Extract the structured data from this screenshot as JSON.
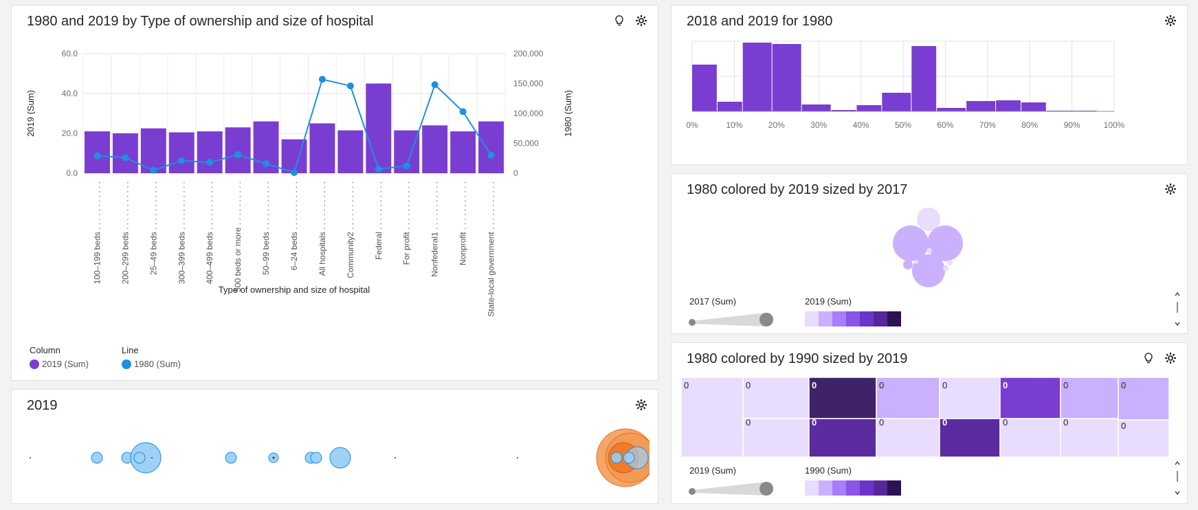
{
  "panel1": {
    "title": "1980 and 2019 by Type of ownership and size of hospital",
    "legend": {
      "column_heading": "Column",
      "line_heading": "Line",
      "column_series": "2019 (Sum)",
      "line_series": "1980 (Sum)"
    },
    "colors": {
      "column": "#7a3dd1",
      "line": "#1e90e0"
    }
  },
  "panel2": {
    "title": "2018 and 2019 for 1980"
  },
  "panel3": {
    "title": "1980 colored by 2019 sized by 2017",
    "size_legend": "2017 (Sum)",
    "color_legend": "2019 (Sum)"
  },
  "panel4": {
    "title": "1980 colored by 1990 sized by 2019",
    "size_legend": "2019 (Sum)",
    "color_legend": "1990 (Sum)",
    "cell_value": "0"
  },
  "panel5": {
    "title": "2019"
  },
  "color_scale": [
    "#e8dcff",
    "#cbb0ff",
    "#a87dfb",
    "#8a54e8",
    "#6c34c8",
    "#552799",
    "#3f1d73",
    "#2b1252"
  ],
  "chart_data": [
    {
      "type": "bar",
      "title": "1980 and 2019 by Type of ownership and size of hospital",
      "xlabel": "Type of ownership and size of hospital",
      "ylabel": "2019 (Sum)",
      "y2label": "1980 (Sum)",
      "ylim": [
        0,
        60
      ],
      "y2lim": [
        0,
        200000
      ],
      "yticks": [
        "60.0",
        "40.0",
        "20.0",
        "0.0"
      ],
      "y2ticks": [
        "200,000",
        "150,000",
        "100,000",
        "50,000",
        "0"
      ],
      "categories": [
        "100–199 beds . . . . . . . . . . .",
        "200–299 beds . . . . . . . . . . .",
        "25–49 beds . . . . . . . . . . .",
        "300–399 beds . . . . . . . . . . .",
        "400–499 beds . . . . . . . . . . .",
        "500 beds or more . . . . . . . . . .",
        "50–99 beds . . . . . . . . . . .",
        "6–24 beds . . . . . . . . . . .",
        "All hospitals . . . . . . . . . . .",
        "Community2 . . . . . . . . . . .",
        "Federal . . . . . . . . . . .",
        "For profit . . . . . . . . . . .",
        "Nonfederal1 . . . . . . . . . . .",
        "Nonprofit . . . . . . . . . . .",
        "State-local government . . . . . . . . . . ."
      ],
      "series": [
        {
          "name": "2019 (Sum)",
          "type": "bar",
          "values": [
            21,
            20,
            22.5,
            20.5,
            21,
            23,
            26,
            17,
            25,
            21.5,
            45,
            21.5,
            24,
            21,
            26
          ]
        },
        {
          "name": "1980 (Sum)",
          "type": "line",
          "values": [
            29000,
            26000,
            5000,
            21000,
            18000,
            31000,
            16000,
            1000,
            157000,
            146000,
            7000,
            12000,
            148000,
            103000,
            30000
          ]
        }
      ],
      "legend": "bottom-left"
    },
    {
      "type": "bar",
      "title": "2018 and 2019 for 1980",
      "xticks": [
        "0%",
        "10%",
        "20%",
        "30%",
        "40%",
        "50%",
        "60%",
        "70%",
        "80%",
        "90%",
        "100%"
      ],
      "bins": [
        [
          0,
          6
        ],
        [
          6,
          12
        ],
        [
          12,
          19
        ],
        [
          19,
          26
        ],
        [
          26,
          33
        ],
        [
          33,
          39
        ],
        [
          39,
          45
        ],
        [
          45,
          52
        ],
        [
          52,
          58
        ],
        [
          58,
          65
        ],
        [
          65,
          72
        ],
        [
          72,
          78
        ],
        [
          78,
          84
        ],
        [
          84,
          91
        ],
        [
          91,
          96
        ]
      ],
      "values": [
        68,
        14,
        100,
        98,
        10,
        2,
        9,
        27,
        95,
        5,
        15,
        16,
        13,
        1,
        1
      ]
    }
  ]
}
